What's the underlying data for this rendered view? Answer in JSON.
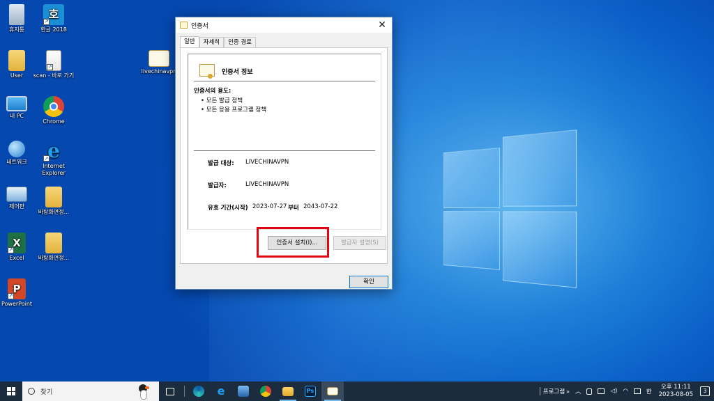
{
  "desktop": {
    "icons": [
      {
        "label": "휴지통"
      },
      {
        "label": "한글 2018",
        "glyph": "호"
      },
      {
        "label": "User"
      },
      {
        "label": "scan - 바로 가기"
      },
      {
        "label": "livechinavpn"
      },
      {
        "label": "내 PC"
      },
      {
        "label": "Chrome"
      },
      {
        "label": "네트워크"
      },
      {
        "label": "Internet Explorer"
      },
      {
        "label": "제어판"
      },
      {
        "label": "바탕화면정..."
      },
      {
        "label": "Excel"
      },
      {
        "label": "바탕화면정..."
      },
      {
        "label": "PowerPoint"
      }
    ]
  },
  "dialog": {
    "title": "인증서",
    "tabs": [
      "일반",
      "자세히",
      "인증 경로"
    ],
    "info_title": "인증서 정보",
    "purpose_title": "인증서의 용도:",
    "purposes": [
      "• 모든 발급 정책",
      "• 모든 응용 프로그램 정책"
    ],
    "issued_to_label": "발급 대상:",
    "issued_to": "LIVECHINAVPN",
    "issued_by_label": "발급자:",
    "issued_by": "LIVECHINAVPN",
    "validity_label": "유효 기간(시작)",
    "valid_from": "2023-07-27",
    "to_label": "부터",
    "valid_to": "2043-07-22",
    "install_button": "인증서 설치(I)...",
    "issuer_statement_button": "발급자 설명(S)",
    "ok_button": "확인",
    "close_glyph": "✕"
  },
  "taskbar": {
    "search_placeholder": "찾기",
    "toolbar_label": "프로그램",
    "chevron": "»",
    "ime": "한",
    "time": "오후 11:11",
    "date": "2023-08-05",
    "notifications": "3"
  },
  "colors": {
    "highlight": "#e30613",
    "accent": "#0078d7",
    "taskbar": "#1c2c3f"
  }
}
